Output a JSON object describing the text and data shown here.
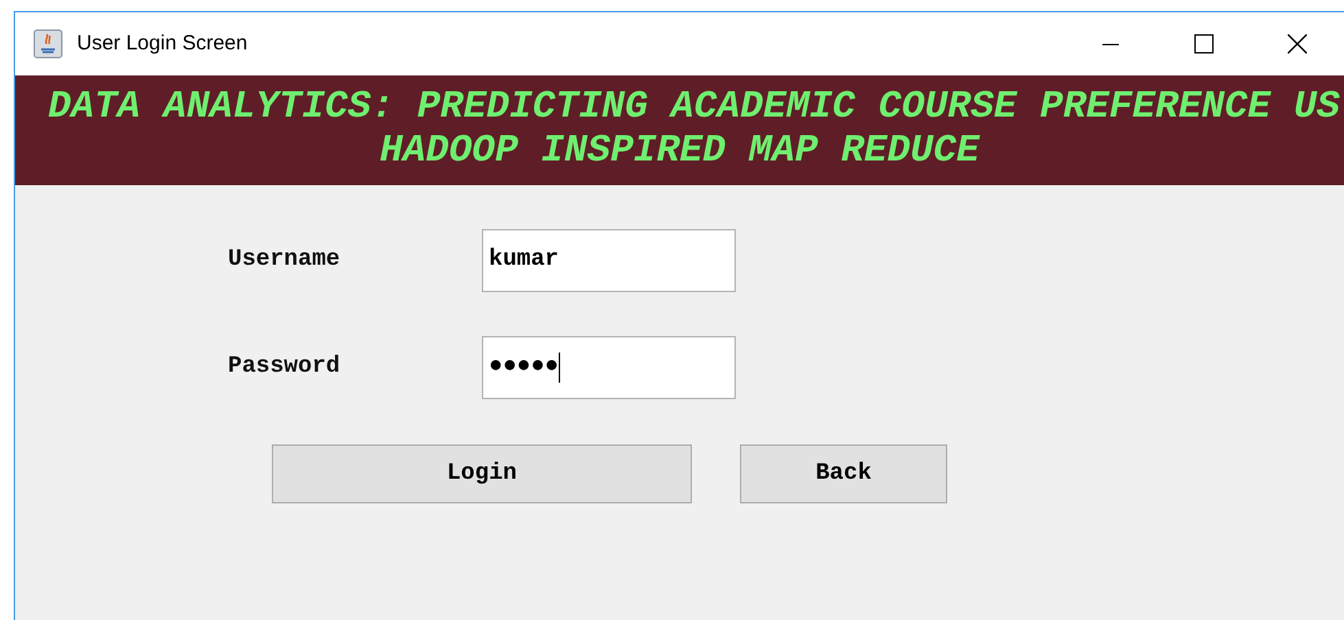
{
  "window": {
    "title": "User Login Screen"
  },
  "banner": {
    "lines": [
      "DATA ANALYTICS: PREDICTING ACADEMIC COURSE PREFERENCE US",
      "HADOOP INSPIRED MAP REDUCE"
    ]
  },
  "form": {
    "fields": [
      {
        "label": "Username",
        "value": "kumar",
        "focused": false
      },
      {
        "label": "Password",
        "value": "●●●●●",
        "focused": true
      }
    ]
  },
  "buttons": [
    "Login",
    "Back"
  ]
}
